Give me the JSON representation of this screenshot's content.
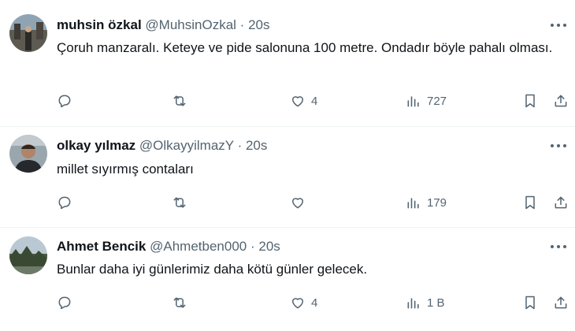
{
  "tweets": [
    {
      "name": "muhsin özkal",
      "handle": "@MuhsinOzkal",
      "separator": "·",
      "time": "20s",
      "text": "Çoruh manzaralı. Keteye ve pide salonuna 100 metre. Ondadır böyle pahalı olması.",
      "likes": "4",
      "views": "727"
    },
    {
      "name": "olkay yılmaz",
      "handle": "@OlkayyilmazY",
      "separator": "·",
      "time": "20s",
      "text": "millet sıyırmış contaları",
      "likes": "",
      "views": "179"
    },
    {
      "name": "Ahmet Bencik",
      "handle": "@Ahmetben000",
      "separator": "·",
      "time": "20s",
      "text": "Bunlar daha iyi günlerimiz daha kötü günler gelecek.",
      "likes": "4",
      "views": "1 B"
    }
  ],
  "icons": {
    "reply": "reply-icon",
    "retweet": "retweet-icon",
    "like": "heart-icon",
    "views": "views-icon",
    "bookmark": "bookmark-icon",
    "share": "share-icon",
    "more": "more-icon"
  },
  "colors": {
    "text": "#0f1419",
    "secondary": "#536471",
    "divider": "#eff3f4"
  }
}
